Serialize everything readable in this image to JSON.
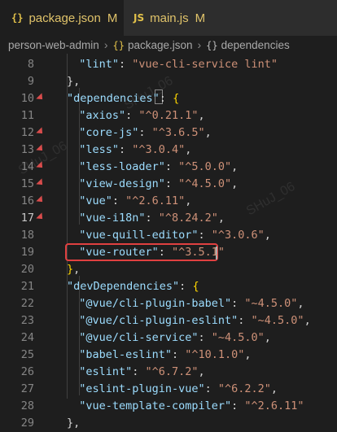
{
  "tabs": [
    {
      "icon": "{}",
      "name": "package.json",
      "flag": "M"
    },
    {
      "icon": "JS",
      "name": "main.js",
      "flag": "M"
    }
  ],
  "breadcrumb": {
    "root": "person-web-admin",
    "file_icon": "{}",
    "file": "package.json",
    "symbol_icon": "{}",
    "symbol": "dependencies"
  },
  "lines": [
    {
      "n": "8",
      "tokens": [
        {
          "t": "\"lint\"",
          "c": "k"
        },
        {
          "t": ": ",
          "c": "p"
        },
        {
          "t": "\"vue-cli-service lint\"",
          "c": "s"
        }
      ],
      "indent": 2
    },
    {
      "n": "9",
      "tokens": [
        {
          "t": "},",
          "c": "p"
        }
      ],
      "indent": 1
    },
    {
      "n": "10",
      "tokens": [
        {
          "t": "\"dependencies\"",
          "c": "k"
        },
        {
          "t": ": ",
          "c": "p"
        },
        {
          "t": "{",
          "c": "b"
        }
      ],
      "indent": 1
    },
    {
      "n": "11",
      "tokens": [
        {
          "t": "\"axios\"",
          "c": "k"
        },
        {
          "t": ": ",
          "c": "p"
        },
        {
          "t": "\"^0.21.1\"",
          "c": "s"
        },
        {
          "t": ",",
          "c": "p"
        }
      ],
      "indent": 2
    },
    {
      "n": "12",
      "tokens": [
        {
          "t": "\"core-js\"",
          "c": "k"
        },
        {
          "t": ": ",
          "c": "p"
        },
        {
          "t": "\"^3.6.5\"",
          "c": "s"
        },
        {
          "t": ",",
          "c": "p"
        }
      ],
      "indent": 2
    },
    {
      "n": "13",
      "tokens": [
        {
          "t": "\"less\"",
          "c": "k"
        },
        {
          "t": ": ",
          "c": "p"
        },
        {
          "t": "\"^3.0.4\"",
          "c": "s"
        },
        {
          "t": ",",
          "c": "p"
        }
      ],
      "indent": 2
    },
    {
      "n": "14",
      "tokens": [
        {
          "t": "\"less-loader\"",
          "c": "k"
        },
        {
          "t": ": ",
          "c": "p"
        },
        {
          "t": "\"^5.0.0\"",
          "c": "s"
        },
        {
          "t": ",",
          "c": "p"
        }
      ],
      "indent": 2
    },
    {
      "n": "15",
      "tokens": [
        {
          "t": "\"view-design\"",
          "c": "k"
        },
        {
          "t": ": ",
          "c": "p"
        },
        {
          "t": "\"^4.5.0\"",
          "c": "s"
        },
        {
          "t": ",",
          "c": "p"
        }
      ],
      "indent": 2
    },
    {
      "n": "16",
      "tokens": [
        {
          "t": "\"vue\"",
          "c": "k"
        },
        {
          "t": ": ",
          "c": "p"
        },
        {
          "t": "\"^2.6.11\"",
          "c": "s"
        },
        {
          "t": ",",
          "c": "p"
        }
      ],
      "indent": 2
    },
    {
      "n": "17",
      "tokens": [
        {
          "t": "\"vue-i18n\"",
          "c": "k"
        },
        {
          "t": ": ",
          "c": "p"
        },
        {
          "t": "\"^8.24.2\"",
          "c": "s"
        },
        {
          "t": ",",
          "c": "p"
        }
      ],
      "indent": 2
    },
    {
      "n": "18",
      "tokens": [
        {
          "t": "\"vue-quill-editor\"",
          "c": "k"
        },
        {
          "t": ": ",
          "c": "p"
        },
        {
          "t": "\"^3.0.6\"",
          "c": "s"
        },
        {
          "t": ",",
          "c": "p"
        }
      ],
      "indent": 2
    },
    {
      "n": "19",
      "tokens": [
        {
          "t": "\"vue-router\"",
          "c": "k"
        },
        {
          "t": ": ",
          "c": "p"
        },
        {
          "t": "\"^3.5.1\"",
          "c": "s"
        }
      ],
      "indent": 2
    },
    {
      "n": "20",
      "tokens": [
        {
          "t": "}",
          "c": "b"
        },
        {
          "t": ",",
          "c": "p"
        }
      ],
      "indent": 1
    },
    {
      "n": "21",
      "tokens": [
        {
          "t": "\"devDependencies\"",
          "c": "k"
        },
        {
          "t": ": ",
          "c": "p"
        },
        {
          "t": "{",
          "c": "b"
        }
      ],
      "indent": 1
    },
    {
      "n": "22",
      "tokens": [
        {
          "t": "\"@vue/cli-plugin-babel\"",
          "c": "k"
        },
        {
          "t": ": ",
          "c": "p"
        },
        {
          "t": "\"~4.5.0\"",
          "c": "s"
        },
        {
          "t": ",",
          "c": "p"
        }
      ],
      "indent": 2
    },
    {
      "n": "23",
      "tokens": [
        {
          "t": "\"@vue/cli-plugin-eslint\"",
          "c": "k"
        },
        {
          "t": ": ",
          "c": "p"
        },
        {
          "t": "\"~4.5.0\"",
          "c": "s"
        },
        {
          "t": ",",
          "c": "p"
        }
      ],
      "indent": 2
    },
    {
      "n": "24",
      "tokens": [
        {
          "t": "\"@vue/cli-service\"",
          "c": "k"
        },
        {
          "t": ": ",
          "c": "p"
        },
        {
          "t": "\"~4.5.0\"",
          "c": "s"
        },
        {
          "t": ",",
          "c": "p"
        }
      ],
      "indent": 2
    },
    {
      "n": "25",
      "tokens": [
        {
          "t": "\"babel-eslint\"",
          "c": "k"
        },
        {
          "t": ": ",
          "c": "p"
        },
        {
          "t": "\"^10.1.0\"",
          "c": "s"
        },
        {
          "t": ",",
          "c": "p"
        }
      ],
      "indent": 2
    },
    {
      "n": "26",
      "tokens": [
        {
          "t": "\"eslint\"",
          "c": "k"
        },
        {
          "t": ": ",
          "c": "p"
        },
        {
          "t": "\"^6.7.2\"",
          "c": "s"
        },
        {
          "t": ",",
          "c": "p"
        }
      ],
      "indent": 2
    },
    {
      "n": "27",
      "tokens": [
        {
          "t": "\"eslint-plugin-vue\"",
          "c": "k"
        },
        {
          "t": ": ",
          "c": "p"
        },
        {
          "t": "\"^6.2.2\"",
          "c": "s"
        },
        {
          "t": ",",
          "c": "p"
        }
      ],
      "indent": 2
    },
    {
      "n": "28",
      "tokens": [
        {
          "t": "\"vue-template-compiler\"",
          "c": "k"
        },
        {
          "t": ": ",
          "c": "p"
        },
        {
          "t": "\"^2.6.11\"",
          "c": "s"
        }
      ],
      "indent": 2
    },
    {
      "n": "29",
      "tokens": [
        {
          "t": "},",
          "c": "p"
        }
      ],
      "indent": 1
    }
  ],
  "active_line": "17",
  "modified_lines": [
    "10",
    "12",
    "13",
    "14",
    "15",
    "16",
    "17"
  ],
  "colors": {
    "key": "#9cdcfe",
    "string": "#ce9178",
    "highlight": "#e04040",
    "tab_modified": "#e0c36a"
  }
}
